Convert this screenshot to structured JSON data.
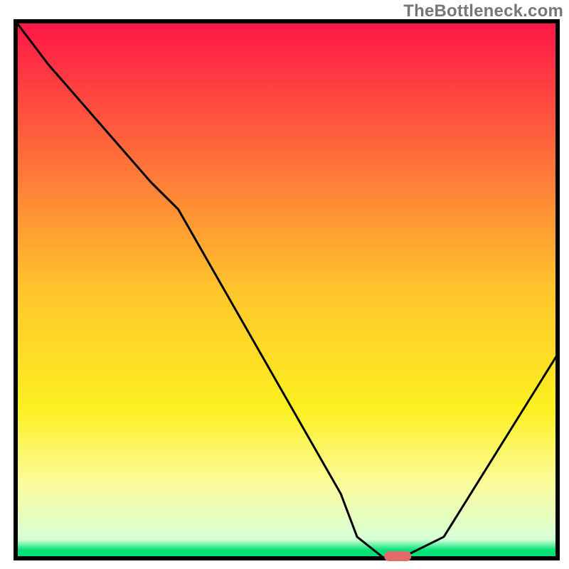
{
  "watermark": "TheBottleneck.com",
  "chart_data": {
    "type": "line",
    "title": "",
    "xlabel": "",
    "ylabel": "",
    "xlim": [
      0,
      100
    ],
    "ylim": [
      0,
      100
    ],
    "background_gradient": [
      {
        "stop": 0.0,
        "color": "#ff1648"
      },
      {
        "stop": 0.25,
        "color": "#ff6d3a"
      },
      {
        "stop": 0.5,
        "color": "#ffc52c"
      },
      {
        "stop": 0.72,
        "color": "#fcf020"
      },
      {
        "stop": 0.86,
        "color": "#fbfc9c"
      },
      {
        "stop": 0.965,
        "color": "#d6ffd6"
      },
      {
        "stop": 0.985,
        "color": "#00e276"
      },
      {
        "stop": 1.0,
        "color": "#00e276"
      }
    ],
    "x": [
      0,
      6,
      25,
      30,
      60,
      63,
      68,
      71,
      79,
      100
    ],
    "values": [
      100,
      92,
      70,
      65,
      12,
      4,
      0,
      0,
      4,
      38
    ],
    "marker": {
      "x_start": 68,
      "x_end": 73,
      "y": 0,
      "color": "#e46a6a"
    }
  }
}
